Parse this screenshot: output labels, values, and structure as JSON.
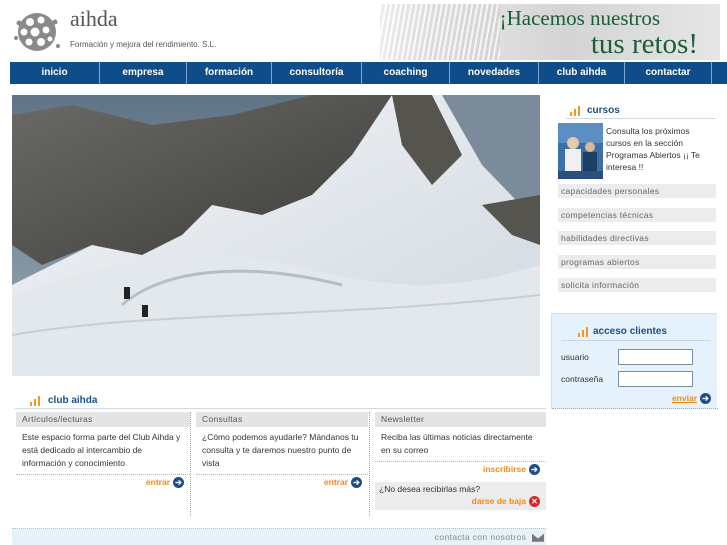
{
  "header": {
    "brand": "aihda",
    "tagline": "Formación y mejora del rendimiento. S.L.",
    "banner_line1": "¡Hacemos nuestros",
    "banner_line2": "tus retos!"
  },
  "nav": [
    {
      "label": "inicio"
    },
    {
      "label": "empresa"
    },
    {
      "label": "formación"
    },
    {
      "label": "consultoría"
    },
    {
      "label": "coaching"
    },
    {
      "label": "novedades"
    },
    {
      "label": "club aihda"
    },
    {
      "label": "contactar"
    }
  ],
  "club": {
    "title": "club aihda",
    "columns": [
      {
        "head": "Artículos/lecturas",
        "text": "Este espacio forma parte del Club Aihda y está dedicado al intercambio de información y conocimiento",
        "link": "entrar"
      },
      {
        "head": "Consultas",
        "text": "¿Cómo podemos ayudarle? Mándanos tu consulta y te daremos nuestro punto de vista",
        "link": "entrar"
      },
      {
        "head": "Newsletter",
        "text": "Reciba las últimas noticias directamente en su correo",
        "link": "inscribirse",
        "unsubscribe_question": "¿No desea recibirlas más?",
        "unsubscribe_link": "darse de baja"
      }
    ]
  },
  "footer": {
    "contact_link": "contacta con nosotros"
  },
  "cursos": {
    "title": "cursos",
    "text": "Consulta los próximos cursos en la sección Programas Abiertos ¡¡ Te interesa !!",
    "menu": [
      "capacidades personales",
      "competencias técnicas",
      "habilidades directivas",
      "programas abiertos",
      "solicita información"
    ]
  },
  "acceso": {
    "title": "acceso clientes",
    "user_label": "usuario",
    "password_label": "contraseña",
    "user_value": "",
    "password_value": "",
    "submit": "enviar"
  },
  "colors": {
    "nav": "#0f4c8a",
    "accent": "#f39a1e",
    "title": "#1d4f86",
    "banner_text": "#1b5e3a"
  }
}
